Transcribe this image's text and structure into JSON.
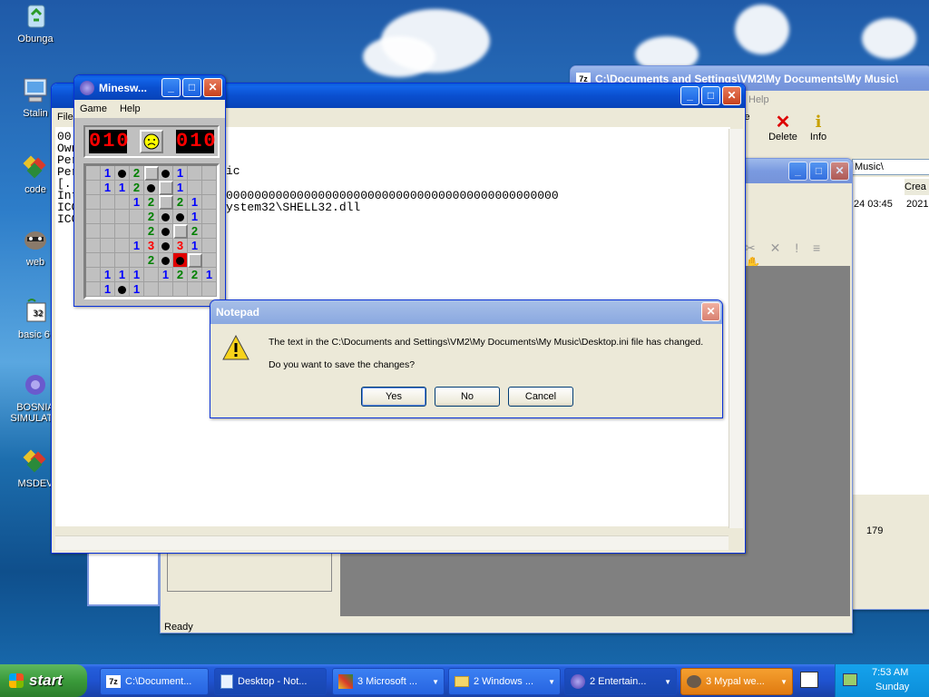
{
  "desktop": {
    "icons": [
      {
        "label": "Obunga",
        "icon": "recycle-bin-icon"
      },
      {
        "label": "Stalin",
        "icon": "computer-icon"
      },
      {
        "label": "code",
        "icon": "msdev-shortcut-icon"
      },
      {
        "label": "web",
        "icon": "raccoon-shortcut-icon"
      },
      {
        "label": "basic 6.",
        "icon": "basic-shortcut-icon"
      },
      {
        "label": "BOSNIA SIMULATO",
        "icon": "game-shortcut-icon"
      },
      {
        "label": "MSDEV",
        "icon": "msdev-shortcut-icon"
      }
    ]
  },
  "sevenzip": {
    "title": "C:\\Documents and Settings\\VM2\\My Documents\\My Music\\",
    "menu_help": "Help",
    "toolbar": [
      {
        "label": "Delete",
        "icon": "red-x-icon"
      },
      {
        "label": "Info",
        "icon": "info-icon"
      }
    ],
    "partial_toolbar_label": "ve",
    "path": "Music\\",
    "col_header": "Crea",
    "row_date": "24 03:45",
    "row_date2": "2021-",
    "status_count": "179"
  },
  "explorer_bg": {
    "status": "Ready"
  },
  "notepad": {
    "menu_file": "File",
    "text_lines": [
      "ic",
      "00000000000000000000000000000000000000000000000",
      "ystem32\\SHELL32.dll"
    ],
    "left_lines": [
      "00",
      "Own",
      "Per",
      "Per",
      "[.",
      "Int",
      "ICO",
      "ICO"
    ]
  },
  "minesweeper": {
    "title": "Minesw...",
    "menu": [
      "Game",
      "Help"
    ],
    "mines_left": "010",
    "timer": "010",
    "grid": [
      [
        "",
        "1",
        "*",
        "2",
        "#",
        "*",
        "1",
        "",
        ""
      ],
      [
        "",
        "1",
        "1",
        "2",
        "*",
        "#",
        "1",
        "",
        ""
      ],
      [
        "",
        "",
        "",
        "1",
        "2",
        "#",
        "2",
        "1",
        ""
      ],
      [
        "",
        "",
        "",
        "",
        "2",
        "*",
        "*",
        "1",
        ""
      ],
      [
        "",
        "",
        "",
        "",
        "2",
        "*",
        "#",
        "2",
        ""
      ],
      [
        "",
        "",
        "",
        "1",
        "3",
        "*",
        "3",
        "1",
        ""
      ],
      [
        "",
        "",
        "",
        "",
        "2",
        "*",
        "X",
        "#",
        ""
      ],
      [
        "",
        "1",
        "1",
        "1",
        "",
        "1",
        "2",
        "2",
        "1"
      ],
      [
        "",
        "1",
        "*",
        "1",
        "",
        "",
        "",
        "",
        ""
      ]
    ],
    "number_colors": {
      "1": "#0000ff",
      "2": "#008000",
      "3": "#ff0000"
    }
  },
  "dialog": {
    "title": "Notepad",
    "message1": "The text in the C:\\Documents and Settings\\VM2\\My Documents\\My Music\\Desktop.ini file has changed.",
    "message2": "Do you want to save the changes?",
    "yes": "Yes",
    "no": "No",
    "cancel": "Cancel",
    "icon": "warning-icon"
  },
  "taskbar": {
    "start": "start",
    "tasks": [
      {
        "label": "C:\\Document...",
        "icon": "7zip-icon"
      },
      {
        "label": "Desktop - Not...",
        "icon": "notepad-icon"
      },
      {
        "label": "3 Microsoft ...",
        "icon": "msdev-icon"
      },
      {
        "label": "2 Windows ...",
        "icon": "folder-icon"
      },
      {
        "label": "2 Entertain...",
        "icon": "minesweeper-icon"
      },
      {
        "label": "3 Mypal we...",
        "icon": "raccoon-icon"
      }
    ],
    "time": "7:53 AM",
    "day": "Sunday"
  }
}
